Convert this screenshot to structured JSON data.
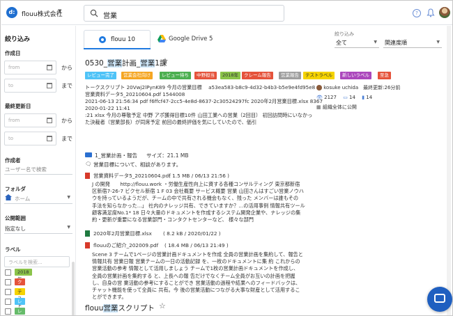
{
  "topbar": {
    "logo_text": "d:",
    "org_name": "flouu株式会社",
    "search_value": "営業"
  },
  "sidebar": {
    "title": "絞り込み",
    "created_label": "作成日",
    "updated_label": "最終更新日",
    "date_from_ph": "from",
    "date_to_ph": "to",
    "suffix_from": "から",
    "suffix_to": "まで",
    "author_label": "作成者",
    "author_placeholder": "ユーザー名で検索",
    "folder_label": "フォルダ",
    "folder_value": "ホーム",
    "scope_label": "公開範囲",
    "scope_value": "指定なし",
    "labels_label": "ラベル",
    "labels_search_placeholder": "ラベルを検索...",
    "labels": [
      {
        "name": "2018年",
        "bg": "#8bc34a",
        "color": "#333"
      },
      {
        "name": "クレーム報告",
        "bg": "#e5533b",
        "color": "#fff"
      },
      {
        "name": "テストラベル",
        "bg": "#f5d300",
        "color": "#333"
      },
      {
        "name": "レビュー完了",
        "bg": "#4fc3f7",
        "color": "#fff"
      },
      {
        "name": "レビュー待ち",
        "bg": "#66bb6a",
        "color": "#fff"
      }
    ]
  },
  "tabs": [
    {
      "label": "flouu 10"
    },
    {
      "label": "Google Drive 5"
    }
  ],
  "sort": {
    "label": "絞り込み",
    "filter_value": "全て",
    "order_value": "関連度順"
  },
  "result1": {
    "title_pre": "0530_",
    "title_hl1": "営業",
    "title_mid": "計画_",
    "title_hl2": "営業",
    "title_post": "1課",
    "tags": [
      {
        "name": "レビュー完了",
        "bg": "#4fc3f7"
      },
      {
        "name": "営業会社向け",
        "bg": "#f5a623"
      },
      {
        "name": "レビュー待ち",
        "bg": "#4caf50"
      },
      {
        "name": "中野担当",
        "bg": "#e5533b"
      },
      {
        "name": "2018年",
        "bg": "#8bc34a"
      },
      {
        "name": "クレーム報告",
        "bg": "#e5533b"
      },
      {
        "name": "営業報告",
        "bg": "#9e9e9e"
      },
      {
        "name": "テストラベル",
        "bg": "#f5d300"
      },
      {
        "name": "新しいラベル",
        "bg": "#ab47bc"
      },
      {
        "name": "至急",
        "bg": "#e5533b"
      }
    ],
    "lines": [
      "トークスクリプト 20Vwj2lPynK89 今月の営業目標 　a53ea583-b8c9-4d32-b4b3-b5e9e4fd95e8",
      "営業資料データ5_20210604.pdf 1544008",
      "2021-06-13 21:56:34 pdf f6ffcf47-2cc5-4e8d-8637-2c30524297fc 2020年2月営業目標.xlsx 8367",
      "2020-01-22 11:41",
      ":21 xlsx 今月の尊敬予定 中野 アポ獲得目標10件 山田工業への営業（2回目） 初回訪問時にいなかっ",
      "た決裁者（営業部長）が同席予定 前回の最終評価を気にしていたので、価引"
    ],
    "owner": "kosuke uchida",
    "updated": "最終更新:26分前",
    "views": "2127",
    "comments": "14",
    "likes": "14",
    "visibility": "組織全体に公開",
    "folder_path": "1_営業計画・報告",
    "folder_size": "サイズ：21.1 MB",
    "comment_text": "営業目標について、相談があります。",
    "files": [
      {
        "name": "営業資料データ5_20210604.pdf",
        "meta": "( 1.5 MB / 06/13 21:56 )",
        "snippet": [
          "J の開発　　http://flouu.work ・労働生産性向上に資する各種コンサルティング 東京都新宿",
          "区新宿7-26-7 ビクセル新宿 1 F 03 会社概要 サービス概要 営業 山田さんはすごい営業ノウハ",
          "ウを持っているようだが、チームの中で共有される機会もなく、残った メンバーは誰もその",
          "手法を知らなかった...」 社内のナレッジ共有、できていますか？...の活用事例 情報共有ツール",
          "顧客満足度No.1* 18 日々大量のドキュメントを作成するシステム開発企業や、ナレッジの集",
          "約・更新が重要になる営業部門・コンタクトセンターなど、 様々な部門"
        ]
      },
      {
        "name": "2020年2月営業目標.xlsx",
        "meta": "( 8.2 kB / 2020/01/22 )"
      },
      {
        "name": "flouuのご紹介_202009.pdf",
        "meta": "( 18.4 MB / 06/13 21:49 )",
        "snippet": [
          "Scene 3 チームで1ページの営業計画ドキュメントを作成 全員の営業計画を集約して、報告と",
          "情報共有 営業日報 営業チームの一日の活動記録 を、一枚のドキュメントに集 約 これからの",
          "営業活動の参考 情報として活用しましょう チームで1枚の営業計画ドキュメントを作成し、",
          "全員の営業計画を集約する と、上長への報 告だけでなくチーム全員がお互いの計画を把握",
          "し、自身の営 業活動の参考にすることができ 営業活動の過程や結果へのフィードバックは、",
          "チャット機能を使って全員に 共有。今 後の営業活動につながる大事な財産として活用するこ",
          "とができます。"
        ]
      }
    ]
  },
  "result2": {
    "title_pre": "flouu",
    "title_hl": "営業",
    "title_post": "スクリプト"
  }
}
